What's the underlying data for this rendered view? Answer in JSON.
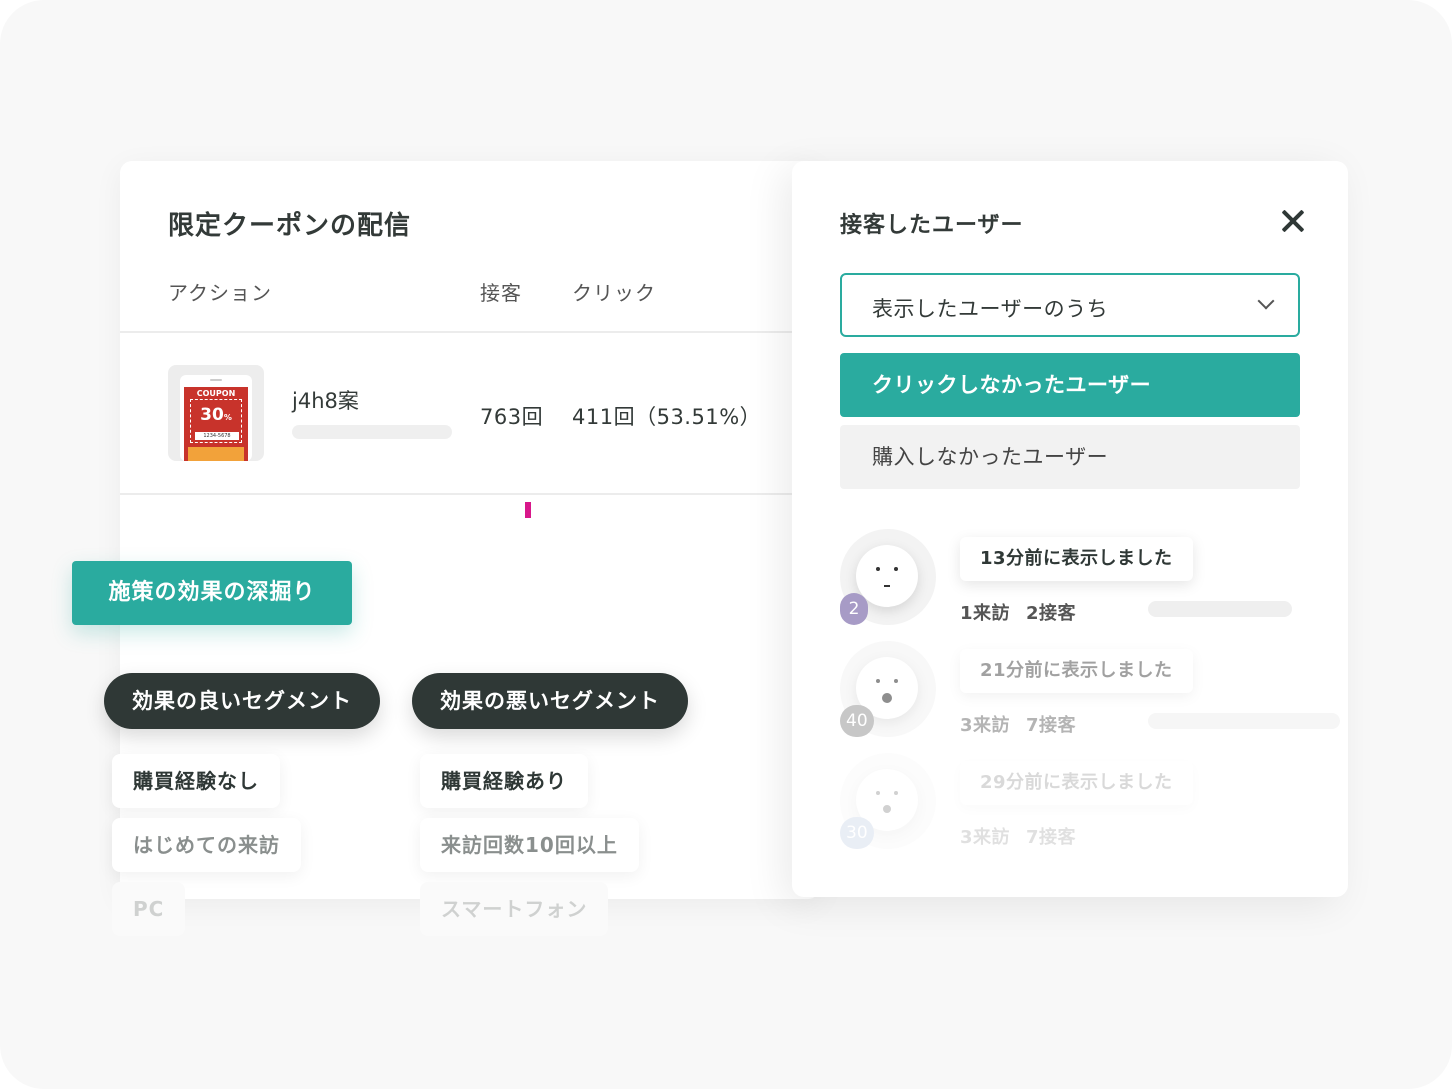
{
  "main": {
    "title": "限定クーポンの配信",
    "columns": {
      "action": "アクション",
      "served": "接客",
      "click": "クリック"
    },
    "row": {
      "variant": "j4h8案",
      "coupon": {
        "brand": "COUPON",
        "discount": "30",
        "unit": "%",
        "code": "1234-5678"
      },
      "served": "763回",
      "click": "411回（53.51%）"
    }
  },
  "tags": {
    "feature": "施策の効果の深掘り",
    "good_segment": "効果の良いセグメント",
    "bad_segment": "効果の悪いセグメント",
    "good_items": [
      "購買経験なし",
      "はじめての来訪",
      "PC"
    ],
    "bad_items": [
      "購買経験あり",
      "来訪回数10回以上",
      "スマートフォン"
    ]
  },
  "panel": {
    "title": "接客したユーザー",
    "select_value": "表示したユーザーのうち",
    "options": [
      "クリックしなかったユーザー",
      "購入しなかったユーザー"
    ],
    "users": [
      {
        "badge": "2",
        "bubble": "13分前に表示しました",
        "visits": "1来訪",
        "served": "2接客"
      },
      {
        "badge": "40",
        "bubble": "21分前に表示しました",
        "visits": "3来訪",
        "served": "7接客"
      },
      {
        "badge": "30",
        "bubble": "29分前に表示しました",
        "visits": "3来訪",
        "served": "7接客"
      }
    ]
  },
  "colors": {
    "accent": "#2aab9f",
    "dark": "#2f3836",
    "cursor": "#d8178a"
  },
  "icons": {
    "close": "close-icon",
    "dropdown": "chevron-down-icon"
  }
}
